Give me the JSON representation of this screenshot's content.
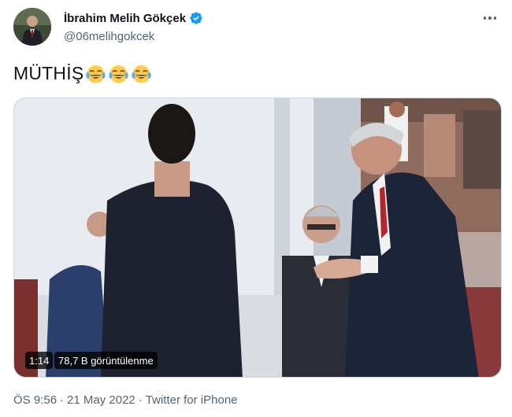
{
  "author": {
    "name": "İbrahim Melih Gökçek",
    "handle": "@06melihgokcek",
    "verified": true,
    "verified_icon": "verified-badge-icon",
    "avatar_icon": "avatar"
  },
  "tweet": {
    "text": "MÜTHİŞ",
    "emojis": [
      "😂",
      "😂",
      "😂"
    ]
  },
  "media": {
    "type": "video",
    "duration": "1:14",
    "views": "78,7 B görüntülenme"
  },
  "meta": {
    "time": "ÖS 9:56",
    "separator": "·",
    "date": "21 May 2022",
    "client": "Twitter for iPhone"
  },
  "colors": {
    "verified_blue": "#1d9bf0",
    "secondary_text": "#536471",
    "primary_text": "#0f1419"
  }
}
